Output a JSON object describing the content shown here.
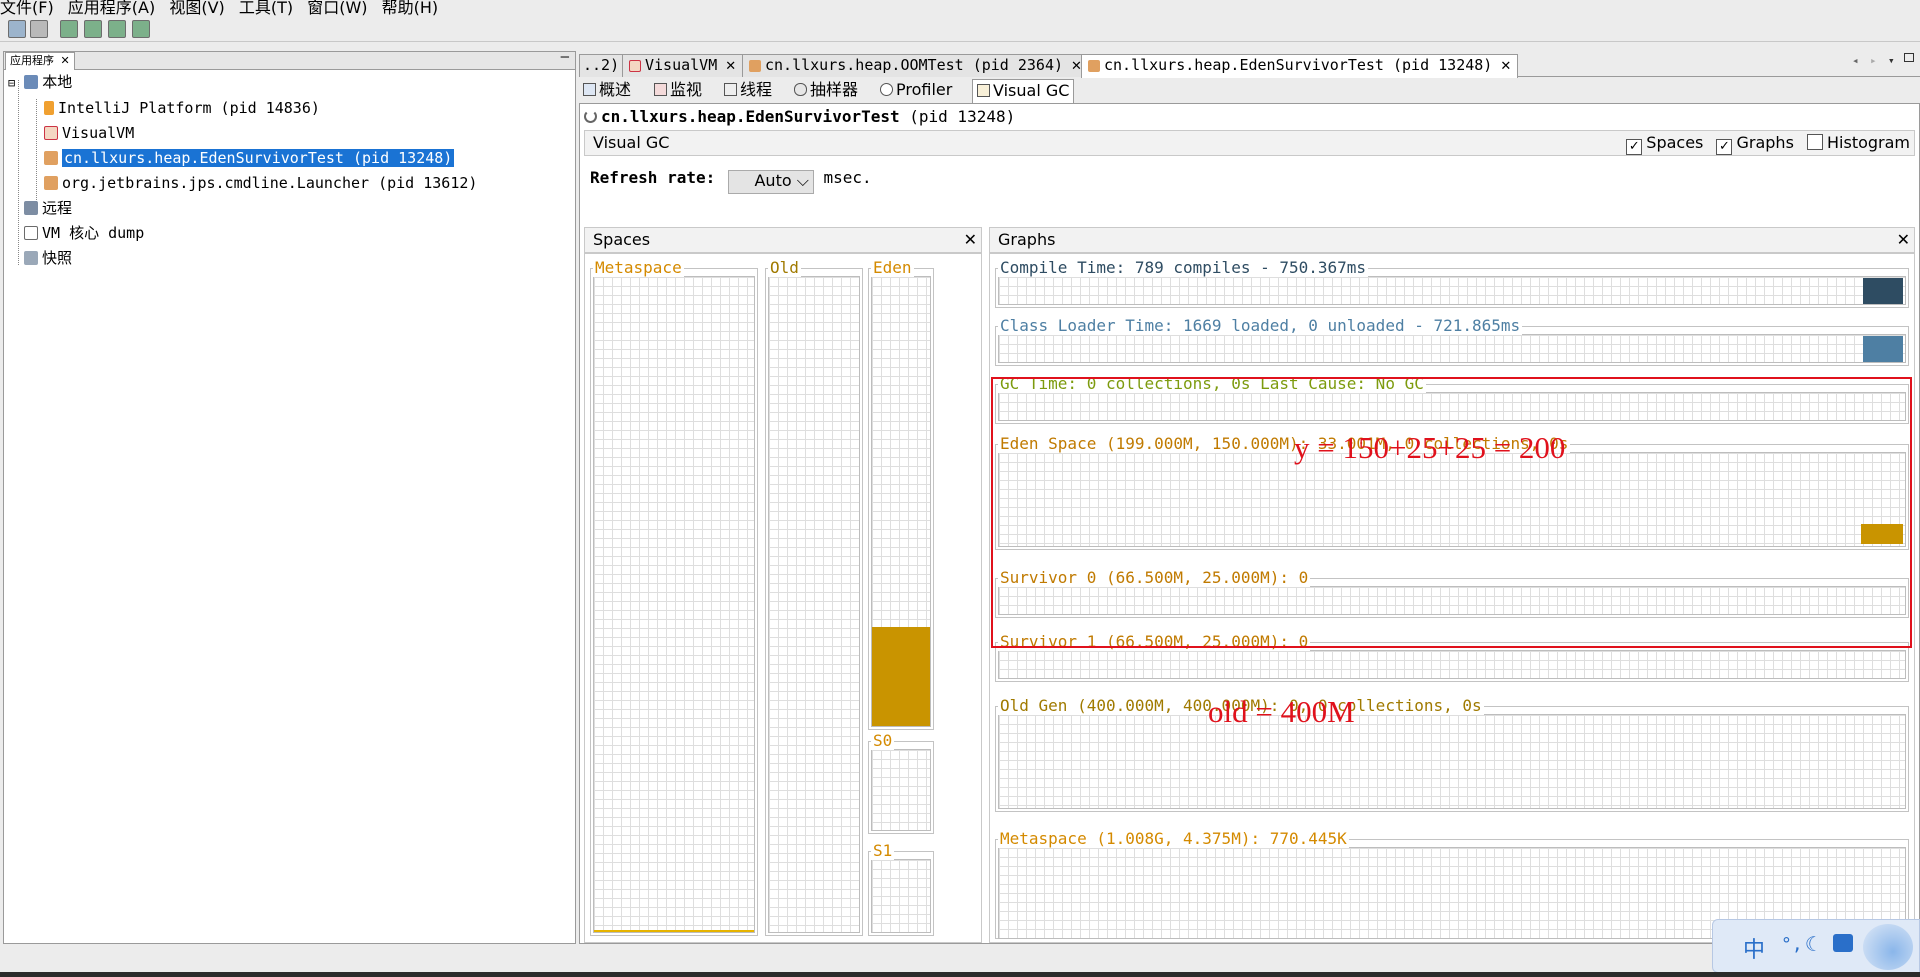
{
  "menubar": {
    "items": [
      "文件(F)",
      "应用程序(A)",
      "视图(V)",
      "工具(T)",
      "窗口(W)",
      "帮助(H)"
    ]
  },
  "left_panel": {
    "tab_label": "应用程序",
    "tree": {
      "local": "本地",
      "children": [
        "IntelliJ Platform (pid 14836)",
        "VisualVM",
        "cn.llxurs.heap.EdenSurvivorTest (pid 13248)",
        "org.jetbrains.jps.cmdline.Launcher (pid 13612)"
      ],
      "remote": "远程",
      "vm_core_dump": "VM 核心 dump",
      "snapshots": "快照"
    }
  },
  "doc_tabs": {
    "overflow": "..2)",
    "tabs": [
      "VisualVM",
      "cn.llxurs.heap.OOMTest (pid 2364)",
      "cn.llxurs.heap.EdenSurvivorTest (pid 13248)"
    ]
  },
  "sub_tabs": [
    "概述",
    "监视",
    "线程",
    "抽样器",
    "Profiler",
    "Visual GC"
  ],
  "app_title": {
    "name": "cn.llxurs.heap.EdenSurvivorTest",
    "pid": "(pid 13248)"
  },
  "visual_gc": {
    "header": "Visual GC",
    "checkboxes": {
      "spaces": {
        "label": "Spaces",
        "checked": true
      },
      "graphs": {
        "label": "Graphs",
        "checked": true
      },
      "histogram": {
        "label": "Histogram",
        "checked": false
      }
    },
    "refresh_label": "Refresh rate:",
    "refresh_value": "Auto",
    "refresh_unit": "msec."
  },
  "spaces_panel": {
    "title": "Spaces",
    "metaspace": "Metaspace",
    "old": "Old",
    "eden": "Eden",
    "s0": "S0",
    "s1": "S1",
    "eden_fill_fraction": 0.22
  },
  "graphs_panel": {
    "title": "Graphs",
    "compile_time": "Compile Time: 789 compiles - 750.367ms",
    "class_loader_time": "Class Loader Time: 1669 loaded, 0 unloaded - 721.865ms",
    "gc_time": "GC Time: 0 collections, 0s Last Cause: No GC",
    "eden_space": "Eden Space (199.000M, 150.000M): 33.001M, 0 collections, 0s",
    "survivor0": "Survivor 0 (66.500M, 25.000M): 0",
    "survivor1": "Survivor 1 (66.500M, 25.000M): 0",
    "old_gen": "Old Gen (400.000M, 400.000M): 0, 0 collections, 0s",
    "metaspace": "Metaspace (1.008G, 4.375M): 770.445K"
  },
  "annotations": {
    "young": "y =  150+25+25 = 200",
    "old": "old = 400M"
  },
  "ime": {
    "label": "中"
  },
  "colors": {
    "eden": "#c99400",
    "compile": "#2e4c62",
    "classloader": "#4e7fa3",
    "gc": "#7d9b0e",
    "selection": "#1a73d4",
    "annotation": "#e0111c"
  }
}
